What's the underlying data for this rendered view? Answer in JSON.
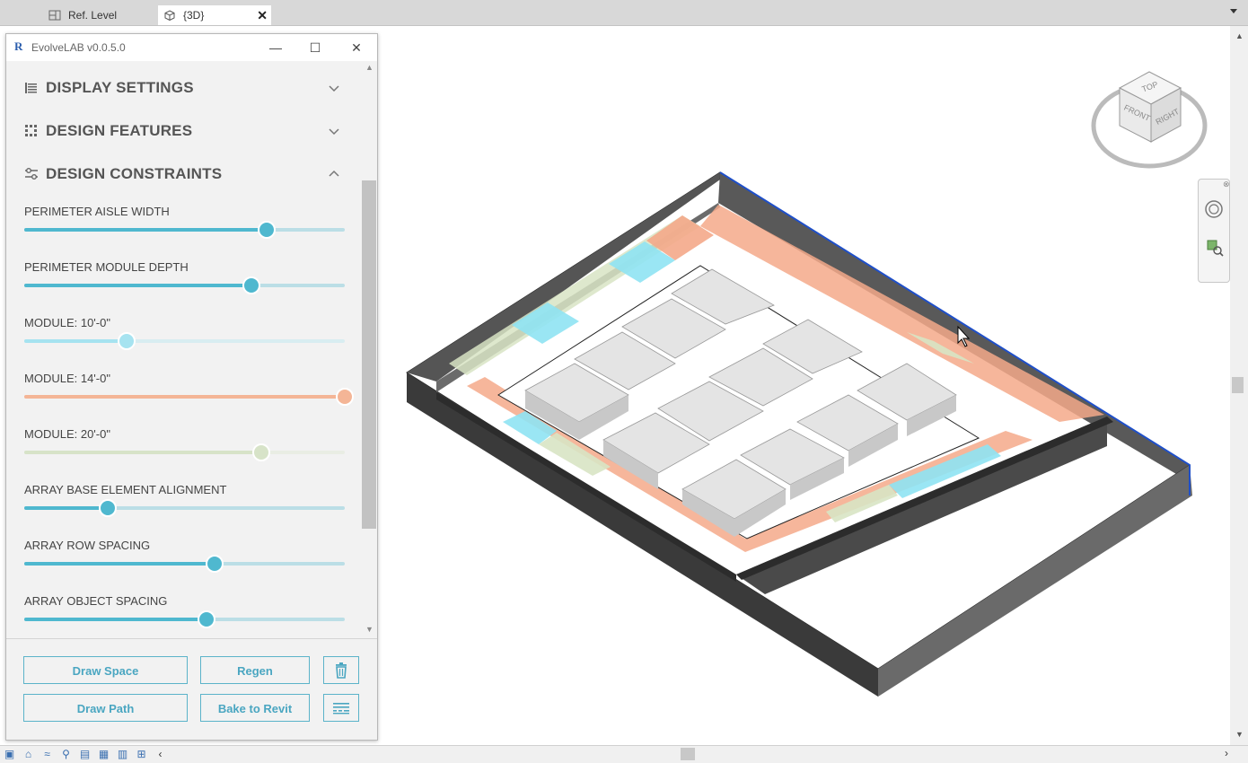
{
  "tabs": [
    {
      "label": "Ref. Level",
      "icon": "floorplan-icon"
    },
    {
      "label": "{3D}",
      "icon": "3d-view-icon",
      "active": true
    }
  ],
  "panel": {
    "app_logo": "R",
    "title": "EvolveLAB v0.0.5.0",
    "sections": [
      {
        "title": "DISPLAY SETTINGS",
        "icon": "display-settings-icon",
        "expanded": false
      },
      {
        "title": "DESIGN FEATURES",
        "icon": "design-features-icon",
        "expanded": false
      },
      {
        "title": "DESIGN CONSTRAINTS",
        "icon": "sliders-icon",
        "expanded": true
      }
    ],
    "sliders": [
      {
        "label": "PERIMETER AISLE WIDTH",
        "value": 0.755,
        "color": "#4fb8cf"
      },
      {
        "label": "PERIMETER MODULE DEPTH",
        "value": 0.71,
        "color": "#4fb8cf"
      },
      {
        "label": "MODULE: 10'-0\"",
        "value": 0.32,
        "color": "#a6e3f0"
      },
      {
        "label": "MODULE: 14'-0\"",
        "value": 1.0,
        "color": "#f4b596"
      },
      {
        "label": "MODULE: 20'-0\"",
        "value": 0.74,
        "color": "#d7e3c8"
      },
      {
        "label": "ARRAY BASE ELEMENT ALIGNMENT",
        "value": 0.26,
        "color": "#4fb8cf"
      },
      {
        "label": "ARRAY ROW SPACING",
        "value": 0.595,
        "color": "#4fb8cf"
      },
      {
        "label": "ARRAY OBJECT SPACING",
        "value": 0.57,
        "color": "#4fb8cf"
      }
    ],
    "buttons": {
      "draw_space": "Draw Space",
      "regen": "Regen",
      "draw_path": "Draw Path",
      "bake": "Bake to Revit"
    }
  },
  "viewcube": {
    "top": "TOP",
    "front": "FRONT",
    "right": "RIGHT"
  },
  "colors": {
    "accent": "#4fb8cf",
    "module_10": "#8fe3f3",
    "module_14": "#f4a98a",
    "module_20": "#d8e4c4",
    "selection": "#1f4fc8"
  }
}
